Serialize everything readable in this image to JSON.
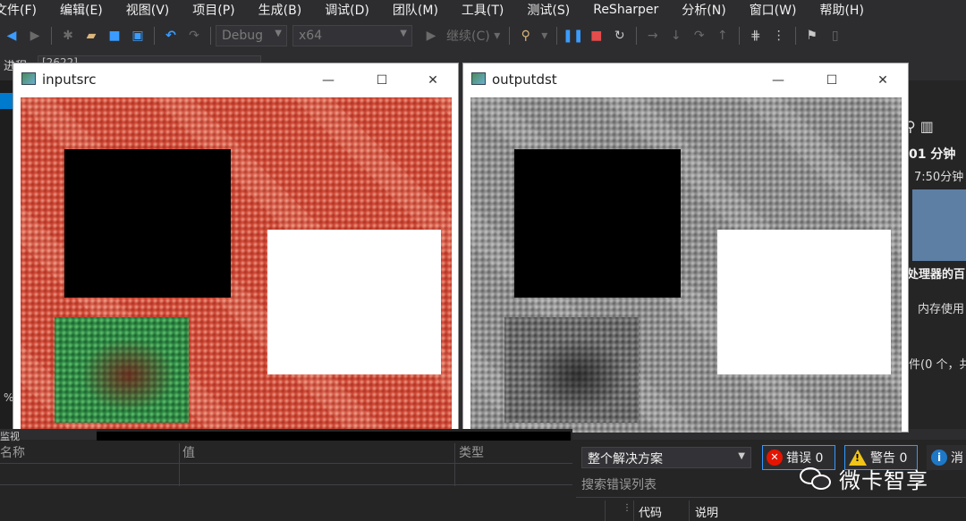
{
  "menu": [
    "文件(F)",
    "编辑(E)",
    "视图(V)",
    "项目(P)",
    "生成(B)",
    "调试(D)",
    "团队(M)",
    "工具(T)",
    "测试(S)",
    "ReSharper",
    "分析(N)",
    "窗口(W)",
    "帮助(H)"
  ],
  "toolbar": {
    "config": "Debug",
    "platform": "x64",
    "continue_label": "继续(C)"
  },
  "process": {
    "label": "进程:",
    "value": "[2622]"
  },
  "windows": {
    "src_title": "inputsrc",
    "dst_title": "outputdst",
    "minimize": "—",
    "maximize": "☐",
    "close": "✕"
  },
  "diag": {
    "time": "01 分钟",
    "time_axis": "7:50分钟",
    "cpu_label": "处理器的百",
    "mem_label": "内存使用",
    "events_label": "件(0 个，共"
  },
  "locals": {
    "strip_label": "监视",
    "col_name": "名称",
    "col_value": "值",
    "col_type": "类型",
    "left_pct": "%"
  },
  "errorlist": {
    "scope": "整个解决方案",
    "errors_label": "错误 0",
    "warnings_label": "警告 0",
    "messages_label": "消",
    "search_placeholder": "搜索错误列表",
    "col_code": "代码",
    "col_desc": "说明"
  },
  "watermark": "微卡智享",
  "colors": {
    "accent": "#3399ff",
    "error": "#e51400",
    "warning": "#f0c419",
    "src_red": "#d14a37",
    "dst_gray": "#8e8e8e"
  }
}
